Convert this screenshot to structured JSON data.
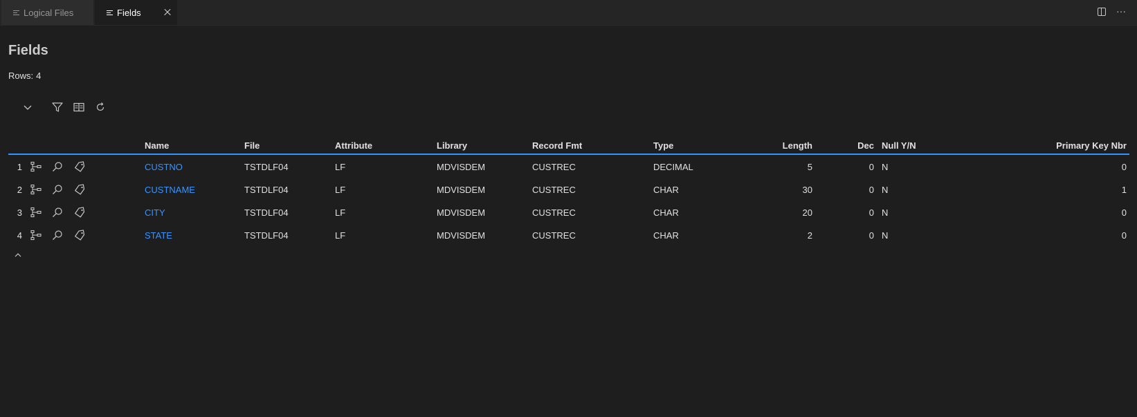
{
  "tabs": [
    {
      "label": "Logical Files",
      "active": false
    },
    {
      "label": "Fields",
      "active": true
    }
  ],
  "page": {
    "title": "Fields",
    "rows_label": "Rows:",
    "rows_count": "4"
  },
  "toolbar": {
    "icons": [
      "chevron-down-icon",
      "filter-icon",
      "columns-icon",
      "refresh-icon"
    ]
  },
  "table": {
    "columns": [
      "Name",
      "File",
      "Attribute",
      "Library",
      "Record Fmt",
      "Type",
      "Length",
      "Dec",
      "Null Y/N",
      "Primary Key Nbr"
    ],
    "row_action_icons": [
      "hierarchy-icon",
      "search-icon",
      "tag-icon"
    ],
    "rows": [
      {
        "num": "1",
        "name": "CUSTNO",
        "file": "TSTDLF04",
        "attribute": "LF",
        "library": "MDVISDEM",
        "record_fmt": "CUSTREC",
        "type": "DECIMAL",
        "length": "5",
        "dec": "0",
        "null": "N",
        "pk": "0"
      },
      {
        "num": "2",
        "name": "CUSTNAME",
        "file": "TSTDLF04",
        "attribute": "LF",
        "library": "MDVISDEM",
        "record_fmt": "CUSTREC",
        "type": "CHAR",
        "length": "30",
        "dec": "0",
        "null": "N",
        "pk": "1"
      },
      {
        "num": "3",
        "name": "CITY",
        "file": "TSTDLF04",
        "attribute": "LF",
        "library": "MDVISDEM",
        "record_fmt": "CUSTREC",
        "type": "CHAR",
        "length": "20",
        "dec": "0",
        "null": "N",
        "pk": "0"
      },
      {
        "num": "4",
        "name": "STATE",
        "file": "TSTDLF04",
        "attribute": "LF",
        "library": "MDVISDEM",
        "record_fmt": "CUSTREC",
        "type": "CHAR",
        "length": "2",
        "dec": "0",
        "null": "N",
        "pk": "0"
      }
    ]
  },
  "colors": {
    "background": "#1e1e1e",
    "link": "#3794ff",
    "header_underline": "#3794ff"
  }
}
